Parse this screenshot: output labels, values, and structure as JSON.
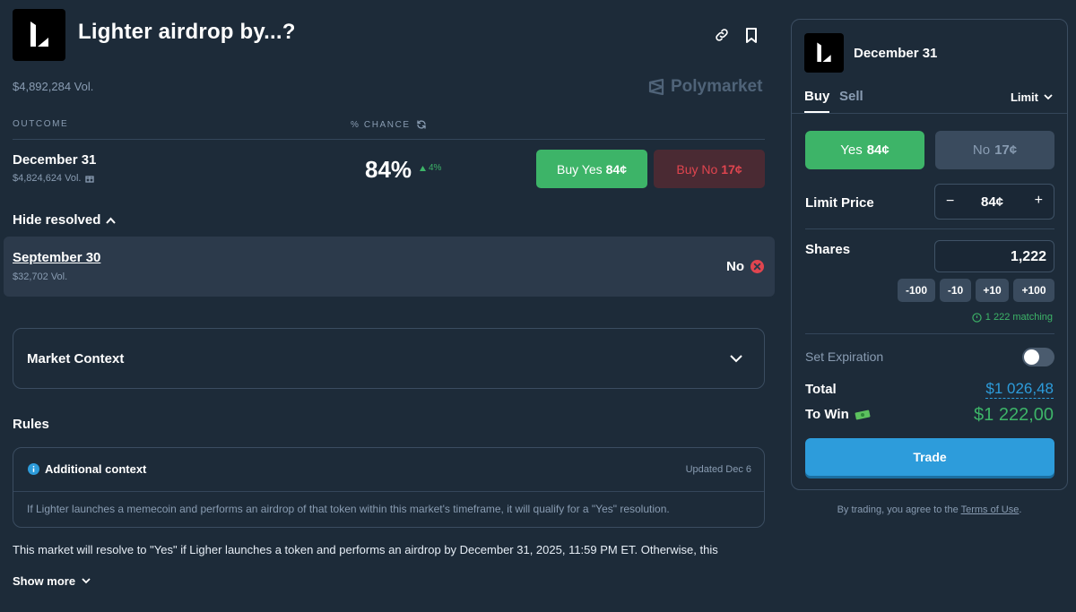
{
  "market": {
    "title": "Lighter airdrop by...?",
    "volume": "$4,892,284 Vol.",
    "brand": "Polymarket"
  },
  "table": {
    "col_outcome": "OUTCOME",
    "col_chance": "% CHANCE"
  },
  "outcomes": [
    {
      "name": "December 31",
      "volume": "$4,824,624 Vol.",
      "chance": "84%",
      "change": "4%",
      "buy_yes_label": "Buy Yes",
      "buy_yes_price": "84¢",
      "buy_no_label": "Buy No",
      "buy_no_price": "17¢"
    }
  ],
  "resolved": {
    "toggle_label": "Hide resolved",
    "items": [
      {
        "name": "September 30",
        "volume": "$32,702 Vol.",
        "result": "No"
      }
    ]
  },
  "context": {
    "title": "Market Context"
  },
  "rules": {
    "heading": "Rules",
    "additional_title": "Additional context",
    "updated": "Updated Dec 6",
    "additional_body": "If Lighter launches a memecoin and performs an airdrop of that token within this market's timeframe, it will qualify for a \"Yes\" resolution.",
    "description": "This market will resolve to \"Yes\" if Ligher launches a token and performs an airdrop by December 31, 2025, 11:59 PM ET. Otherwise, this",
    "show_more": "Show more"
  },
  "trade_panel": {
    "outcome_title": "December 31",
    "tab_buy": "Buy",
    "tab_sell": "Sell",
    "order_type": "Limit",
    "yes_label": "Yes",
    "yes_price": "84¢",
    "no_label": "No",
    "no_price": "17¢",
    "limit_price_label": "Limit Price",
    "limit_price_minus": "−",
    "limit_price_value": "84¢",
    "limit_price_plus": "+",
    "shares_label": "Shares",
    "shares_value": "1,222",
    "increments": [
      "-100",
      "-10",
      "+10",
      "+100"
    ],
    "matching": "1 222 matching",
    "expiration_label": "Set Expiration",
    "expiration_on": false,
    "total_label": "Total",
    "total_value": "$1 026,48",
    "to_win_label": "To Win",
    "to_win_emoji": "💸",
    "to_win_value": "$1 222,00",
    "trade_button": "Trade",
    "terms_prefix": "By trading, you agree to the",
    "terms_link": "Terms of Use",
    "terms_suffix": "."
  },
  "colors": {
    "background": "#1d2b39",
    "green": "#3db468",
    "red": "#e0454f",
    "blue": "#2d9cdb",
    "muted": "#899cb2"
  }
}
